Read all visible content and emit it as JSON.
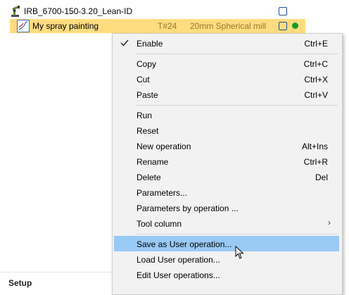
{
  "tree": {
    "robot": {
      "label": "IRB_6700-150-3.20_Lean-ID",
      "icon": "robot-arm-icon"
    },
    "operation": {
      "label": "My spray painting",
      "tool": "T#24",
      "description": "20mm Spherical mill",
      "icon": "spray-path-icon",
      "highlight_color": "#ffdc80",
      "status_color": "#139c2c"
    }
  },
  "panel": {
    "setup_label": "Setup"
  },
  "context_menu": {
    "hover_color": "#99c9f5",
    "items": [
      {
        "label": "Enable",
        "shortcut": "Ctrl+E",
        "checked": true
      },
      {
        "label": "Copy",
        "shortcut": "Ctrl+C"
      },
      {
        "label": "Cut",
        "shortcut": "Ctrl+X"
      },
      {
        "label": "Paste",
        "shortcut": "Ctrl+V"
      },
      {
        "label": "Run",
        "shortcut": ""
      },
      {
        "label": "Reset",
        "shortcut": ""
      },
      {
        "label": "New operation",
        "shortcut": "Alt+Ins"
      },
      {
        "label": "Rename",
        "shortcut": "Ctrl+R"
      },
      {
        "label": "Delete",
        "shortcut": "Del"
      },
      {
        "label": "Parameters...",
        "shortcut": ""
      },
      {
        "label": "Parameters by operation ...",
        "shortcut": ""
      },
      {
        "label": "Tool column",
        "shortcut": "",
        "submenu_arrow": "›"
      },
      {
        "label": "Save as User operation...",
        "shortcut": "",
        "hovered": true
      },
      {
        "label": "Load User operation...",
        "shortcut": ""
      },
      {
        "label": "Edit User operations...",
        "shortcut": ""
      }
    ]
  }
}
